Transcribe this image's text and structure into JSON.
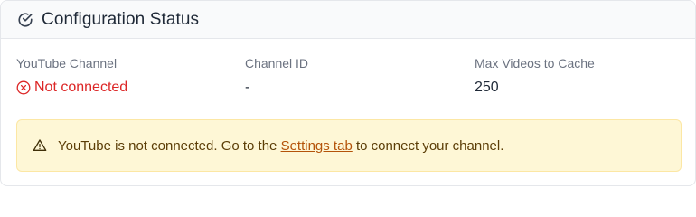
{
  "header": {
    "title": "Configuration Status",
    "icon": "check-circle-icon"
  },
  "fields": [
    {
      "label": "YouTube Channel",
      "value": "Not connected",
      "icon": "x-circle-icon",
      "status_color": "#dc2626"
    },
    {
      "label": "Channel ID",
      "value": "-"
    },
    {
      "label": "Max Videos to Cache",
      "value": "250"
    }
  ],
  "alert": {
    "icon": "warning-triangle-icon",
    "text_before": "YouTube is not connected. Go to the ",
    "link_text": "Settings tab",
    "text_after": " to connect your channel.",
    "background": "#fef7d6"
  }
}
